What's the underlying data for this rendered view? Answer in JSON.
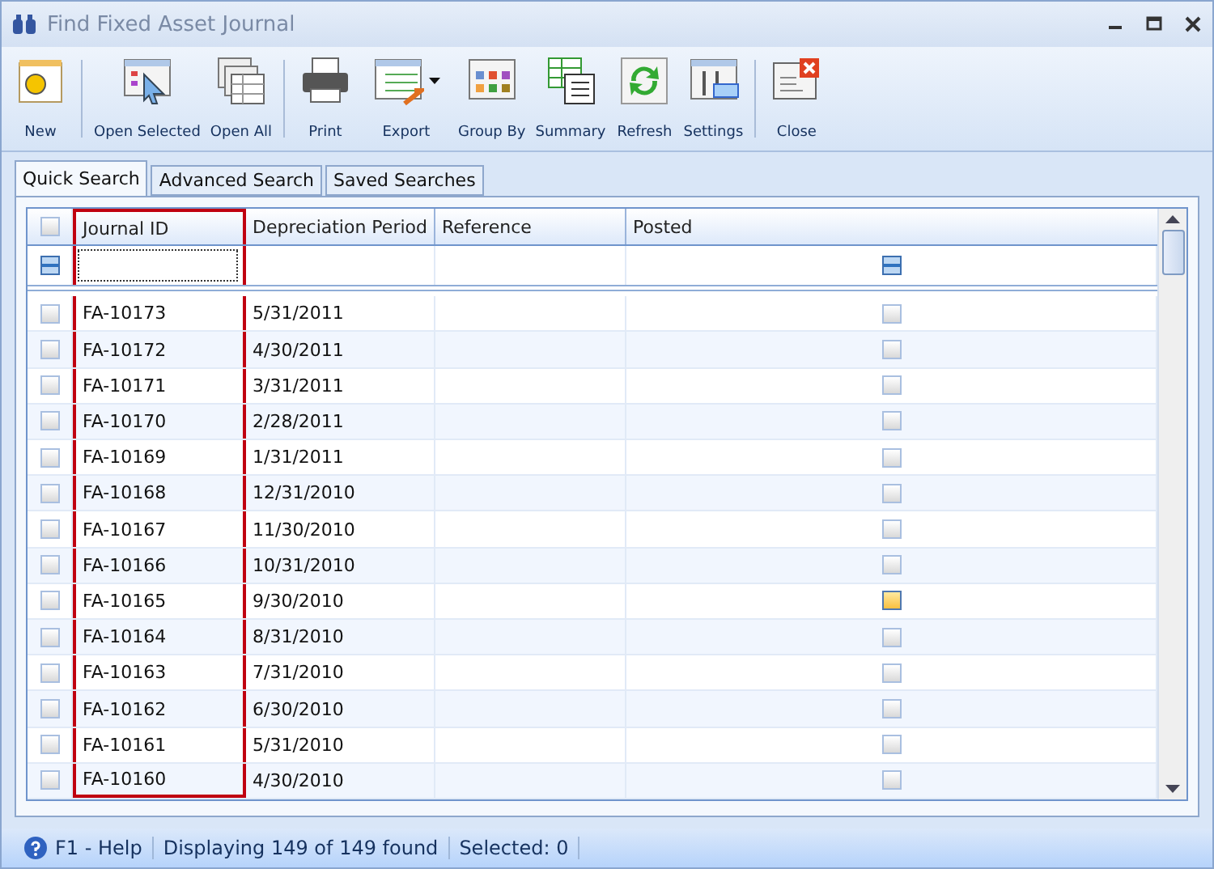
{
  "window": {
    "title": "Find Fixed Asset Journal"
  },
  "toolbar": [
    {
      "label": "New",
      "kind": "new"
    },
    {
      "kind": "separator"
    },
    {
      "label": "Open Selected",
      "kind": "open"
    },
    {
      "label": "Open All",
      "kind": "openall"
    },
    {
      "kind": "separator"
    },
    {
      "label": "Print",
      "kind": "print"
    },
    {
      "label": "Export",
      "kind": "export"
    },
    {
      "label": "Group By",
      "kind": "group"
    },
    {
      "label": "Summary",
      "kind": "summary"
    },
    {
      "label": "Refresh",
      "kind": "refresh"
    },
    {
      "label": "Settings",
      "kind": "settings"
    },
    {
      "kind": "separator"
    },
    {
      "label": "Close",
      "kind": "close"
    }
  ],
  "tabs": [
    {
      "label": "Quick Search",
      "selected": true
    },
    {
      "label": "Advanced Search",
      "selected": false
    },
    {
      "label": "Saved Searches",
      "selected": false
    }
  ],
  "table": {
    "select_all_checked": false,
    "filter": {
      "select_indeterminate": true,
      "posted_indeterminate": true
    },
    "columns": [
      {
        "label": "Journal ID",
        "outlined": true
      },
      {
        "label": "Depreciation Period",
        "outlined": false
      },
      {
        "label": "Reference",
        "outlined": false
      },
      {
        "label": "Posted",
        "outlined": false
      }
    ],
    "rows": [
      {
        "journal_id": "FA-10173",
        "period": "5/31/2011",
        "checked": false,
        "posted": false,
        "hovered": false
      },
      {
        "journal_id": "FA-10172",
        "period": "4/30/2011",
        "checked": false,
        "posted": false,
        "hovered": false
      },
      {
        "journal_id": "FA-10171",
        "period": "3/31/2011",
        "checked": false,
        "posted": false,
        "hovered": false
      },
      {
        "journal_id": "FA-10170",
        "period": "2/28/2011",
        "checked": false,
        "posted": false,
        "hovered": false
      },
      {
        "journal_id": "FA-10169",
        "period": "1/31/2011",
        "checked": false,
        "posted": false,
        "hovered": false
      },
      {
        "journal_id": "FA-10168",
        "period": "12/31/2010",
        "checked": false,
        "posted": false,
        "hovered": false
      },
      {
        "journal_id": "FA-10167",
        "period": "11/30/2010",
        "checked": false,
        "posted": false,
        "hovered": false
      },
      {
        "journal_id": "FA-10166",
        "period": "10/31/2010",
        "checked": false,
        "posted": false,
        "hovered": false
      },
      {
        "journal_id": "FA-10165",
        "period": "9/30/2010",
        "checked": false,
        "posted": false,
        "hovered": true
      },
      {
        "journal_id": "FA-10164",
        "period": "8/31/2010",
        "checked": false,
        "posted": false,
        "hovered": false
      },
      {
        "journal_id": "FA-10163",
        "period": "7/31/2010",
        "checked": false,
        "posted": false,
        "hovered": false
      },
      {
        "journal_id": "FA-10162",
        "period": "6/30/2010",
        "checked": false,
        "posted": false,
        "hovered": false
      },
      {
        "journal_id": "FA-10161",
        "period": "5/31/2010",
        "checked": false,
        "posted": false,
        "hovered": false
      },
      {
        "journal_id": "FA-10160",
        "period": "4/30/2010",
        "checked": false,
        "posted": false,
        "hovered": false
      }
    ]
  },
  "status_bar": {
    "help": "F1 - Help",
    "displaying": "Displaying 149 of 149 found",
    "selected": "Selected: 0"
  }
}
